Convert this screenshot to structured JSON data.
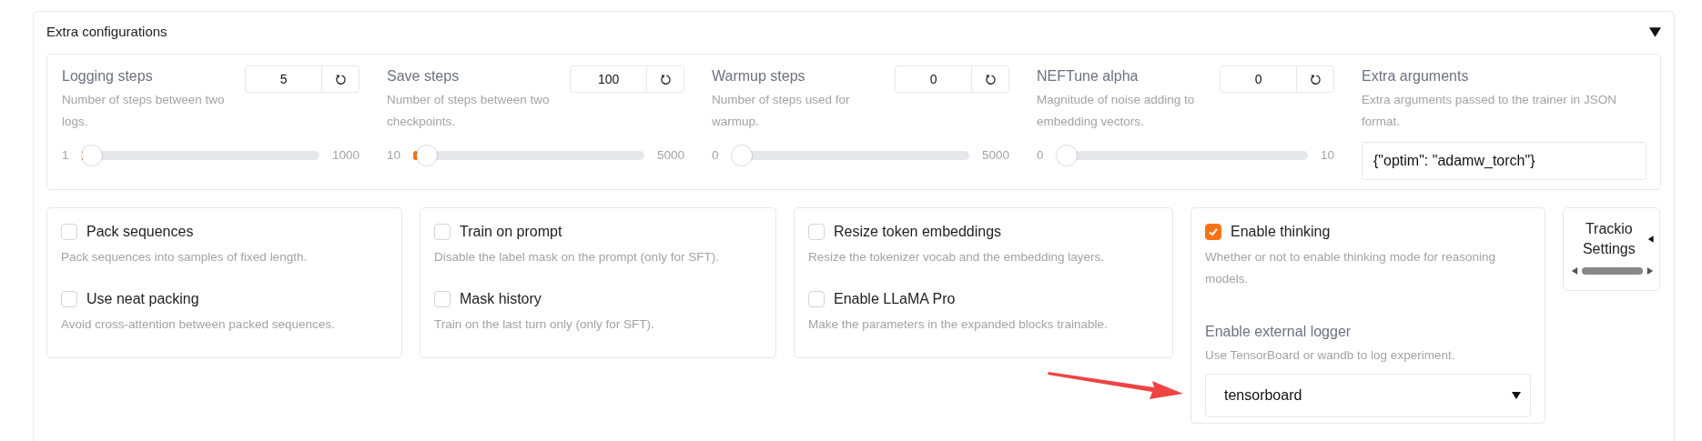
{
  "panel": {
    "title": "Extra configurations",
    "expanded": true
  },
  "sliders": [
    {
      "label": "Logging steps",
      "description": "Number of steps between two logs.",
      "value": "5",
      "min": "1",
      "max": "1000",
      "level": 0.004
    },
    {
      "label": "Save steps",
      "description": "Number of steps between two checkpoints.",
      "value": "100",
      "min": "10",
      "max": "5000",
      "level": 0.018
    },
    {
      "label": "Warmup steps",
      "description": "Number of steps used for warmup.",
      "value": "0",
      "min": "0",
      "max": "5000",
      "level": 0
    },
    {
      "label": "NEFTune alpha",
      "description": "Magnitude of noise adding to embedding vectors.",
      "value": "0",
      "min": "0",
      "max": "10",
      "level": 0
    }
  ],
  "extra_arguments": {
    "label": "Extra arguments",
    "description": "Extra arguments passed to the trainer in JSON format.",
    "value": "{\"optim\": \"adamw_torch\"}"
  },
  "groups": [
    {
      "items": [
        {
          "kind": "checkbox",
          "label": "Pack sequences",
          "description": "Pack sequences into samples of fixed length.",
          "checked": false
        },
        {
          "kind": "checkbox",
          "label": "Use neat packing",
          "description": "Avoid cross-attention between packed sequences.",
          "checked": false
        }
      ]
    },
    {
      "items": [
        {
          "kind": "checkbox",
          "label": "Train on prompt",
          "description": "Disable the label mask on the prompt (only for SFT).",
          "checked": false
        },
        {
          "kind": "checkbox",
          "label": "Mask history",
          "description": "Train on the last turn only (only for SFT).",
          "checked": false
        }
      ]
    },
    {
      "items": [
        {
          "kind": "checkbox",
          "label": "Resize token embeddings",
          "description": "Resize the tokenizer vocab and the embedding layers.",
          "checked": false
        },
        {
          "kind": "checkbox",
          "label": "Enable LLaMA Pro",
          "description": "Make the parameters in the expanded blocks trainable.",
          "checked": false
        }
      ]
    },
    {
      "items": [
        {
          "kind": "checkbox",
          "label": "Enable thinking",
          "description": "Whether or not to enable thinking mode for reasoning models.",
          "checked": true
        },
        {
          "kind": "dropdown",
          "label": "Enable external logger",
          "description": "Use TensorBoard or wandb to log experiment.",
          "value": "tensorboard"
        }
      ]
    }
  ],
  "trackio": {
    "title": "Trackio Settings",
    "expanded": false
  }
}
